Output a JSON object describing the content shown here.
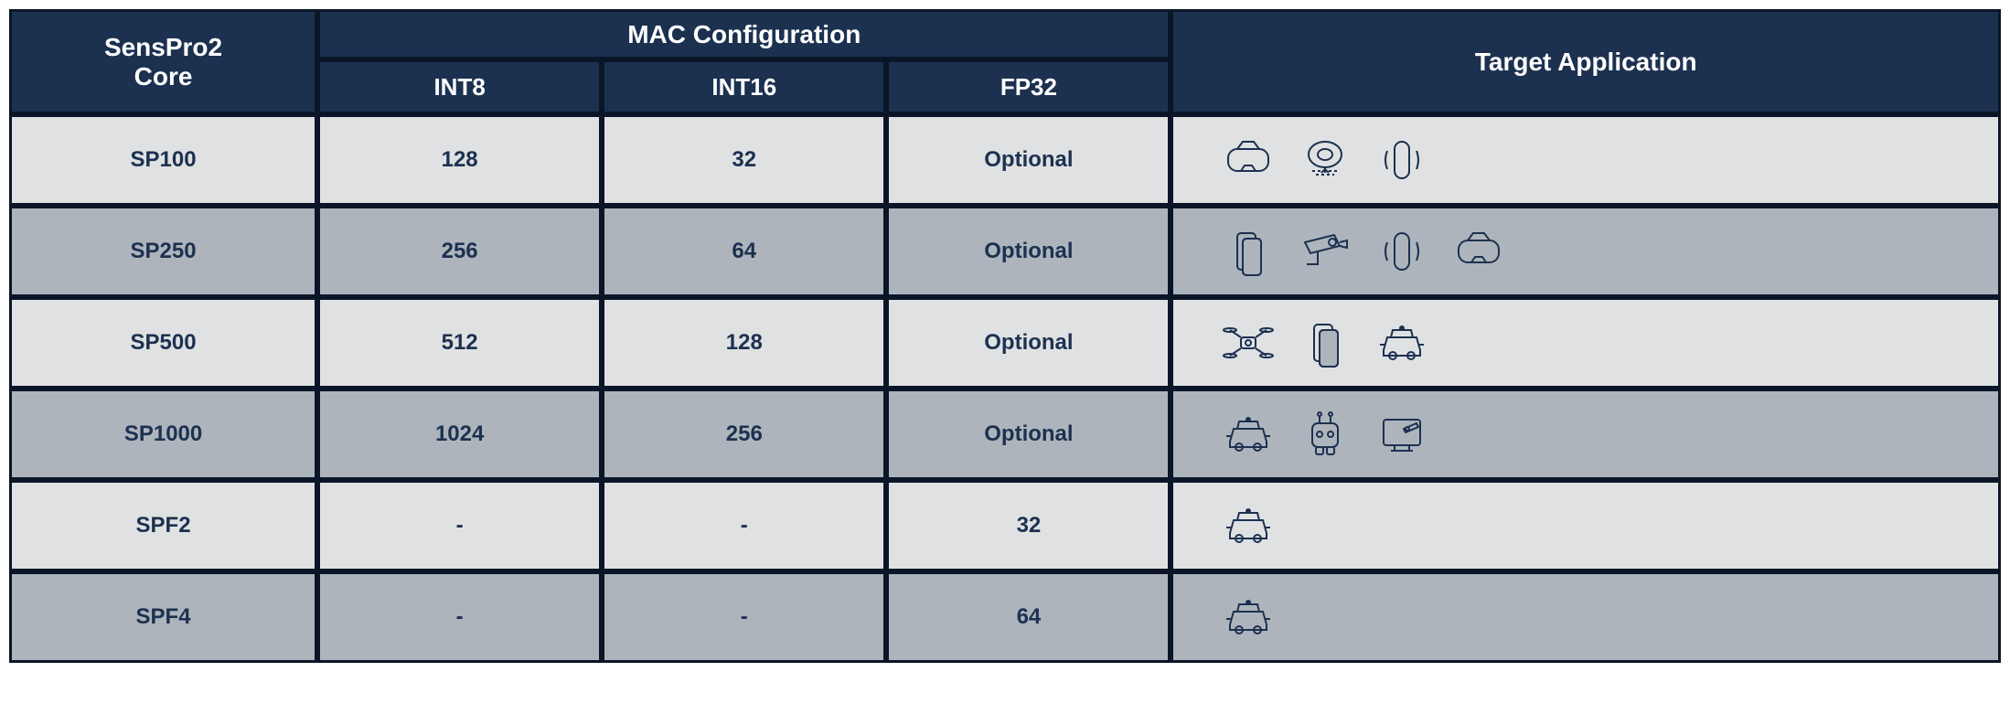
{
  "headers": {
    "core": "SensPro2\nCore",
    "mac": "MAC Configuration",
    "int8": "INT8",
    "int16": "INT16",
    "fp32": "FP32",
    "target": "Target Application"
  },
  "rows": [
    {
      "core": "SP100",
      "int8": "128",
      "int16": "32",
      "fp32": "Optional",
      "apps": [
        "vr-headset",
        "robot-vacuum",
        "smart-speaker"
      ],
      "shade": "light"
    },
    {
      "core": "SP250",
      "int8": "256",
      "int16": "64",
      "fp32": "Optional",
      "apps": [
        "smartphone",
        "security-camera",
        "smart-speaker",
        "vr-headset"
      ],
      "shade": "dark"
    },
    {
      "core": "SP500",
      "int8": "512",
      "int16": "128",
      "fp32": "Optional",
      "apps": [
        "drone",
        "smartphone",
        "car"
      ],
      "shade": "light"
    },
    {
      "core": "SP1000",
      "int8": "1024",
      "int16": "256",
      "fp32": "Optional",
      "apps": [
        "car",
        "robot",
        "smart-tv"
      ],
      "shade": "dark"
    },
    {
      "core": "SPF2",
      "int8": "-",
      "int16": "-",
      "fp32": "32",
      "apps": [
        "car"
      ],
      "shade": "light"
    },
    {
      "core": "SPF4",
      "int8": "-",
      "int16": "-",
      "fp32": "64",
      "apps": [
        "car"
      ],
      "shade": "dark"
    }
  ],
  "chart_data": {
    "type": "table",
    "title": "SensPro2 Core MAC Configuration and Target Applications",
    "columns": [
      "SensPro2 Core",
      "INT8",
      "INT16",
      "FP32",
      "Target Application"
    ],
    "data": [
      [
        "SP100",
        128,
        32,
        "Optional",
        [
          "vr-headset",
          "robot-vacuum",
          "smart-speaker"
        ]
      ],
      [
        "SP250",
        256,
        64,
        "Optional",
        [
          "smartphone",
          "security-camera",
          "smart-speaker",
          "vr-headset"
        ]
      ],
      [
        "SP500",
        512,
        128,
        "Optional",
        [
          "drone",
          "smartphone",
          "car"
        ]
      ],
      [
        "SP1000",
        1024,
        256,
        "Optional",
        [
          "car",
          "robot",
          "smart-tv"
        ]
      ],
      [
        "SPF2",
        null,
        null,
        32,
        [
          "car"
        ]
      ],
      [
        "SPF4",
        null,
        null,
        64,
        [
          "car"
        ]
      ]
    ]
  }
}
